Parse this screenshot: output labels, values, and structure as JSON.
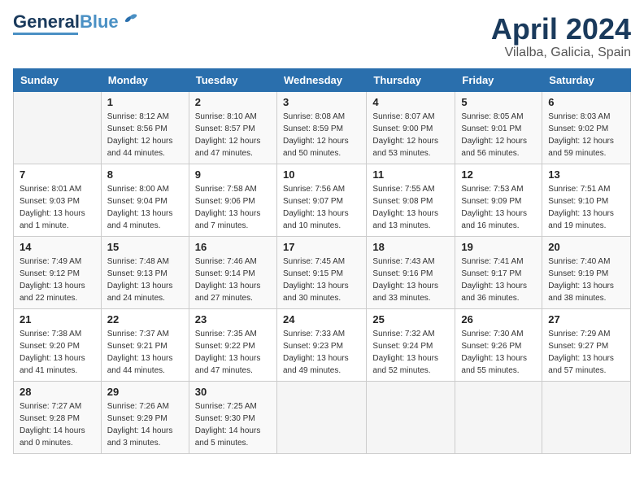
{
  "header": {
    "logo_line1": "General",
    "logo_line2": "Blue",
    "month_year": "April 2024",
    "location": "Vilalba, Galicia, Spain"
  },
  "columns": [
    "Sunday",
    "Monday",
    "Tuesday",
    "Wednesday",
    "Thursday",
    "Friday",
    "Saturday"
  ],
  "weeks": [
    [
      {
        "day": "",
        "info": ""
      },
      {
        "day": "1",
        "info": "Sunrise: 8:12 AM\nSunset: 8:56 PM\nDaylight: 12 hours\nand 44 minutes."
      },
      {
        "day": "2",
        "info": "Sunrise: 8:10 AM\nSunset: 8:57 PM\nDaylight: 12 hours\nand 47 minutes."
      },
      {
        "day": "3",
        "info": "Sunrise: 8:08 AM\nSunset: 8:59 PM\nDaylight: 12 hours\nand 50 minutes."
      },
      {
        "day": "4",
        "info": "Sunrise: 8:07 AM\nSunset: 9:00 PM\nDaylight: 12 hours\nand 53 minutes."
      },
      {
        "day": "5",
        "info": "Sunrise: 8:05 AM\nSunset: 9:01 PM\nDaylight: 12 hours\nand 56 minutes."
      },
      {
        "day": "6",
        "info": "Sunrise: 8:03 AM\nSunset: 9:02 PM\nDaylight: 12 hours\nand 59 minutes."
      }
    ],
    [
      {
        "day": "7",
        "info": "Sunrise: 8:01 AM\nSunset: 9:03 PM\nDaylight: 13 hours\nand 1 minute."
      },
      {
        "day": "8",
        "info": "Sunrise: 8:00 AM\nSunset: 9:04 PM\nDaylight: 13 hours\nand 4 minutes."
      },
      {
        "day": "9",
        "info": "Sunrise: 7:58 AM\nSunset: 9:06 PM\nDaylight: 13 hours\nand 7 minutes."
      },
      {
        "day": "10",
        "info": "Sunrise: 7:56 AM\nSunset: 9:07 PM\nDaylight: 13 hours\nand 10 minutes."
      },
      {
        "day": "11",
        "info": "Sunrise: 7:55 AM\nSunset: 9:08 PM\nDaylight: 13 hours\nand 13 minutes."
      },
      {
        "day": "12",
        "info": "Sunrise: 7:53 AM\nSunset: 9:09 PM\nDaylight: 13 hours\nand 16 minutes."
      },
      {
        "day": "13",
        "info": "Sunrise: 7:51 AM\nSunset: 9:10 PM\nDaylight: 13 hours\nand 19 minutes."
      }
    ],
    [
      {
        "day": "14",
        "info": "Sunrise: 7:49 AM\nSunset: 9:12 PM\nDaylight: 13 hours\nand 22 minutes."
      },
      {
        "day": "15",
        "info": "Sunrise: 7:48 AM\nSunset: 9:13 PM\nDaylight: 13 hours\nand 24 minutes."
      },
      {
        "day": "16",
        "info": "Sunrise: 7:46 AM\nSunset: 9:14 PM\nDaylight: 13 hours\nand 27 minutes."
      },
      {
        "day": "17",
        "info": "Sunrise: 7:45 AM\nSunset: 9:15 PM\nDaylight: 13 hours\nand 30 minutes."
      },
      {
        "day": "18",
        "info": "Sunrise: 7:43 AM\nSunset: 9:16 PM\nDaylight: 13 hours\nand 33 minutes."
      },
      {
        "day": "19",
        "info": "Sunrise: 7:41 AM\nSunset: 9:17 PM\nDaylight: 13 hours\nand 36 minutes."
      },
      {
        "day": "20",
        "info": "Sunrise: 7:40 AM\nSunset: 9:19 PM\nDaylight: 13 hours\nand 38 minutes."
      }
    ],
    [
      {
        "day": "21",
        "info": "Sunrise: 7:38 AM\nSunset: 9:20 PM\nDaylight: 13 hours\nand 41 minutes."
      },
      {
        "day": "22",
        "info": "Sunrise: 7:37 AM\nSunset: 9:21 PM\nDaylight: 13 hours\nand 44 minutes."
      },
      {
        "day": "23",
        "info": "Sunrise: 7:35 AM\nSunset: 9:22 PM\nDaylight: 13 hours\nand 47 minutes."
      },
      {
        "day": "24",
        "info": "Sunrise: 7:33 AM\nSunset: 9:23 PM\nDaylight: 13 hours\nand 49 minutes."
      },
      {
        "day": "25",
        "info": "Sunrise: 7:32 AM\nSunset: 9:24 PM\nDaylight: 13 hours\nand 52 minutes."
      },
      {
        "day": "26",
        "info": "Sunrise: 7:30 AM\nSunset: 9:26 PM\nDaylight: 13 hours\nand 55 minutes."
      },
      {
        "day": "27",
        "info": "Sunrise: 7:29 AM\nSunset: 9:27 PM\nDaylight: 13 hours\nand 57 minutes."
      }
    ],
    [
      {
        "day": "28",
        "info": "Sunrise: 7:27 AM\nSunset: 9:28 PM\nDaylight: 14 hours\nand 0 minutes."
      },
      {
        "day": "29",
        "info": "Sunrise: 7:26 AM\nSunset: 9:29 PM\nDaylight: 14 hours\nand 3 minutes."
      },
      {
        "day": "30",
        "info": "Sunrise: 7:25 AM\nSunset: 9:30 PM\nDaylight: 14 hours\nand 5 minutes."
      },
      {
        "day": "",
        "info": ""
      },
      {
        "day": "",
        "info": ""
      },
      {
        "day": "",
        "info": ""
      },
      {
        "day": "",
        "info": ""
      }
    ]
  ]
}
